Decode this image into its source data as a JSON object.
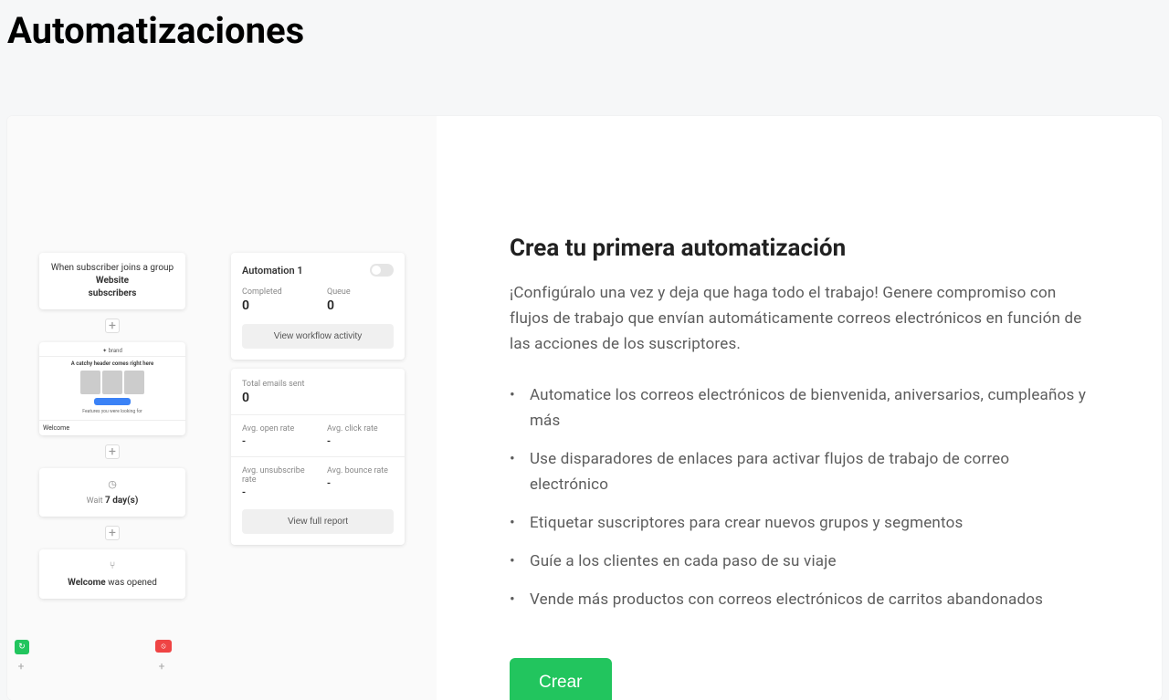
{
  "page": {
    "title": "Automatizaciones"
  },
  "preview": {
    "workflow": {
      "trigger_line1": "When subscriber joins a",
      "trigger_line2": "group",
      "trigger_group": "Website",
      "trigger_group2": "subscribers",
      "email_header_tag": "A catchy header comes right here",
      "email_features": "Features you were looking for",
      "email_name": "Welcome",
      "wait_label": "Wait",
      "wait_days": "7 day(s)",
      "opened_prefix": "Welcome",
      "opened_suffix": "was opened"
    },
    "stats": {
      "title": "Automation 1",
      "completed_label": "Completed",
      "completed_value": "0",
      "queue_label": "Queue",
      "queue_value": "0",
      "view_workflow_btn": "View workflow activity",
      "total_sent_label": "Total emails sent",
      "total_sent_value": "0",
      "open_rate_label": "Avg. open rate",
      "open_rate_value": "-",
      "click_rate_label": "Avg. click rate",
      "click_rate_value": "-",
      "unsub_rate_label": "Avg. unsubscribe rate",
      "unsub_rate_value": "-",
      "bounce_rate_label": "Avg. bounce rate",
      "bounce_rate_value": "-",
      "view_report_btn": "View full report"
    }
  },
  "content": {
    "heading": "Crea tu primera automatización",
    "description": "¡Configúralo una vez y deja que haga todo el trabajo! Genere compromiso con flujos de trabajo que envían automáticamente correos electrónicos en función de las acciones de los suscriptores.",
    "features": [
      "Automatice los correos electrónicos de bienvenida, aniversarios, cumpleaños y más",
      "Use disparadores de enlaces para activar flujos de trabajo de correo electrónico",
      "Etiquetar suscriptores para crear nuevos grupos y segmentos",
      "Guíe a los clientes en cada paso de su viaje",
      "Vende más productos con correos electrónicos de carritos abandonados"
    ],
    "create_button": "Crear"
  }
}
